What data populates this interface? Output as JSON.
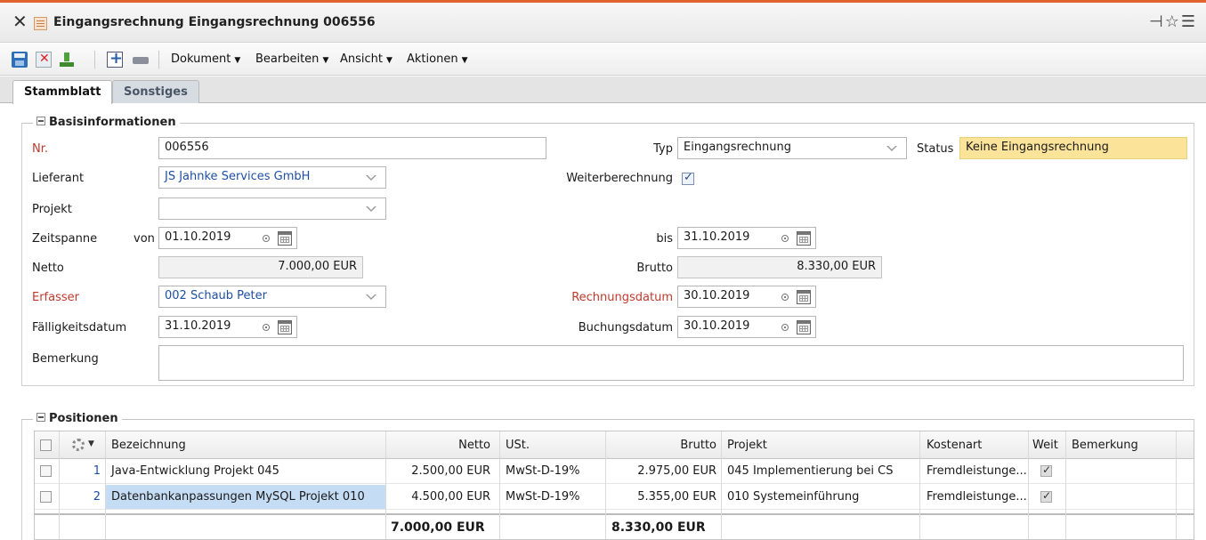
{
  "window": {
    "title": "Eingangsrechnung Eingangsrechnung 006556"
  },
  "toolbar": {
    "menus": [
      "Dokument",
      "Bearbeiten",
      "Ansicht",
      "Aktionen"
    ]
  },
  "tabs": [
    "Stammblatt",
    "Sonstiges"
  ],
  "basis": {
    "legend": "Basisinformationen",
    "nr_label": "Nr.",
    "nr_value": "006556",
    "typ_label": "Typ",
    "typ_value": "Eingangsrechnung",
    "status_label": "Status",
    "status_value": "Keine Eingangsrechnung",
    "lieferant_label": "Lieferant",
    "lieferant_value": "JS Jahnke Services GmbH",
    "weiterberechnung_label": "Weiterberechnung",
    "weiterberechnung_checked": true,
    "projekt_label": "Projekt",
    "projekt_value": "",
    "zeitspanne_label": "Zeitspanne",
    "von_label": "von",
    "von_value": "01.10.2019",
    "bis_label": "bis",
    "bis_value": "31.10.2019",
    "netto_label": "Netto",
    "netto_value": "7.000,00 EUR",
    "brutto_label": "Brutto",
    "brutto_value": "8.330,00 EUR",
    "erfasser_label": "Erfasser",
    "erfasser_value": "002 Schaub Peter",
    "rechnungsdatum_label": "Rechnungsdatum",
    "rechnungsdatum_value": "30.10.2019",
    "faelligkeitsdatum_label": "Fälligkeitsdatum",
    "faelligkeitsdatum_value": "31.10.2019",
    "buchungsdatum_label": "Buchungsdatum",
    "buchungsdatum_value": "30.10.2019",
    "bemerkung_label": "Bemerkung",
    "bemerkung_value": ""
  },
  "positionen": {
    "legend": "Positionen",
    "columns": [
      "Bezeichnung",
      "Netto",
      "USt.",
      "Brutto",
      "Projekt",
      "Kostenart",
      "Weit",
      "Bemerkung"
    ],
    "rows": [
      {
        "nr": "1",
        "bezeichnung": "Java-Entwicklung Projekt 045",
        "netto": "2.500,00 EUR",
        "ust": "MwSt-D-19%",
        "brutto": "2.975,00 EUR",
        "projekt": "045 Implementierung bei CS",
        "kostenart": "Fremdleistunge...",
        "weiter": true,
        "bemerkung": ""
      },
      {
        "nr": "2",
        "bezeichnung": "Datenbankanpassungen MySQL Projekt 010",
        "netto": "4.500,00 EUR",
        "ust": "MwSt-D-19%",
        "brutto": "5.355,00 EUR",
        "projekt": "010 Systemeinführung",
        "kostenart": "Fremdleistunge...",
        "weiter": true,
        "bemerkung": ""
      }
    ],
    "total_netto": "7.000,00 EUR",
    "total_brutto": "8.330,00 EUR"
  },
  "colors": {
    "accent_topline": "#e0622c",
    "status_bg": "#fbe39a",
    "required_label": "#c0392b",
    "link_blue": "#1f4fa3",
    "selected_cell": "#c5dcf5"
  }
}
